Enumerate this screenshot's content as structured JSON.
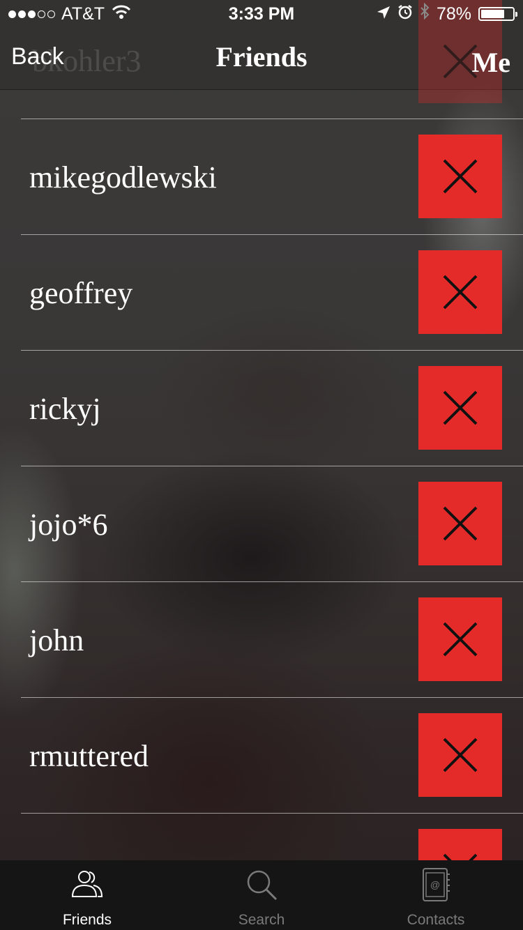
{
  "status_bar": {
    "carrier": "AT&T",
    "signal_bars_filled": 3,
    "signal_bars_total": 5,
    "time": "3:33 PM",
    "battery_percent": "78%",
    "battery_level": 0.78,
    "icons": [
      "signal-icon",
      "wifi-icon",
      "location-arrow-icon",
      "alarm-icon",
      "bluetooth-icon",
      "battery-icon"
    ]
  },
  "nav": {
    "back_label": "Back",
    "title": "Friends",
    "right_label": "Me",
    "ghost_username": "bkohler3"
  },
  "friends": [
    {
      "username": "mikegodlewski"
    },
    {
      "username": "geoffrey"
    },
    {
      "username": "rickyj"
    },
    {
      "username": "jojo*6"
    },
    {
      "username": "john"
    },
    {
      "username": "rmuttered"
    }
  ],
  "remove_icon": "close-x-icon",
  "colors": {
    "remove_button": "#e52a2a",
    "tab_bar": "#151515",
    "tab_active": "#ffffff",
    "tab_inactive": "#7a7a7a"
  },
  "tabs": [
    {
      "label": "Friends",
      "icon": "friends-icon",
      "active": true
    },
    {
      "label": "Search",
      "icon": "search-icon",
      "active": false
    },
    {
      "label": "Contacts",
      "icon": "contacts-icon",
      "active": false
    }
  ]
}
